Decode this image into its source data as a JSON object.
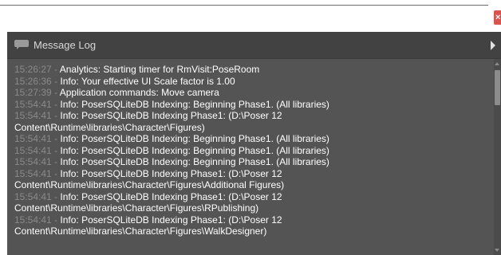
{
  "window": {
    "close_glyph": "×"
  },
  "panel": {
    "title": "Message Log",
    "icon": "speech-bubble-icon",
    "accent_close_color": "#d9534f"
  },
  "log": [
    {
      "time": "15:26:27",
      "separator": "-",
      "message": "Analytics: Starting timer for RmVisit:PoseRoom"
    },
    {
      "time": "15:26:36",
      "separator": "-",
      "message": "Info: Your effective UI Scale factor is 1.00"
    },
    {
      "time": "15:27:39",
      "separator": "-",
      "message": "Application commands: Move camera"
    },
    {
      "time": "15:54:41",
      "separator": "-",
      "message": "Info: PoserSQLiteDB Indexing: Beginning Phase1. (All libraries)"
    },
    {
      "time": "15:54:41",
      "separator": "-",
      "message": "Info: PoserSQLiteDB Indexing Phase1: (D:\\Poser 12"
    },
    {
      "time": "",
      "separator": "",
      "message": "Content\\Runtime\\libraries\\Character\\Figures)"
    },
    {
      "time": "15:54:41",
      "separator": "-",
      "message": "Info: PoserSQLiteDB Indexing: Beginning Phase1. (All libraries)"
    },
    {
      "time": "15:54:41",
      "separator": "-",
      "message": "Info: PoserSQLiteDB Indexing: Beginning Phase1. (All libraries)"
    },
    {
      "time": "15:54:41",
      "separator": "-",
      "message": "Info: PoserSQLiteDB Indexing: Beginning Phase1. (All libraries)"
    },
    {
      "time": "15:54:41",
      "separator": "-",
      "message": "Info: PoserSQLiteDB Indexing Phase1: (D:\\Poser 12"
    },
    {
      "time": "",
      "separator": "",
      "message": "Content\\Runtime\\libraries\\Character\\Figures\\Additional Figures)"
    },
    {
      "time": "15:54:41",
      "separator": "-",
      "message": "Info: PoserSQLiteDB Indexing Phase1: (D:\\Poser 12"
    },
    {
      "time": "",
      "separator": "",
      "message": "Content\\Runtime\\libraries\\Character\\Figures\\RPublishing)"
    },
    {
      "time": "15:54:41",
      "separator": "-",
      "message": "Info: PoserSQLiteDB Indexing Phase1: (D:\\Poser 12"
    },
    {
      "time": "",
      "separator": "",
      "message": "Content\\Runtime\\libraries\\Character\\Figures\\WalkDesigner)"
    }
  ]
}
